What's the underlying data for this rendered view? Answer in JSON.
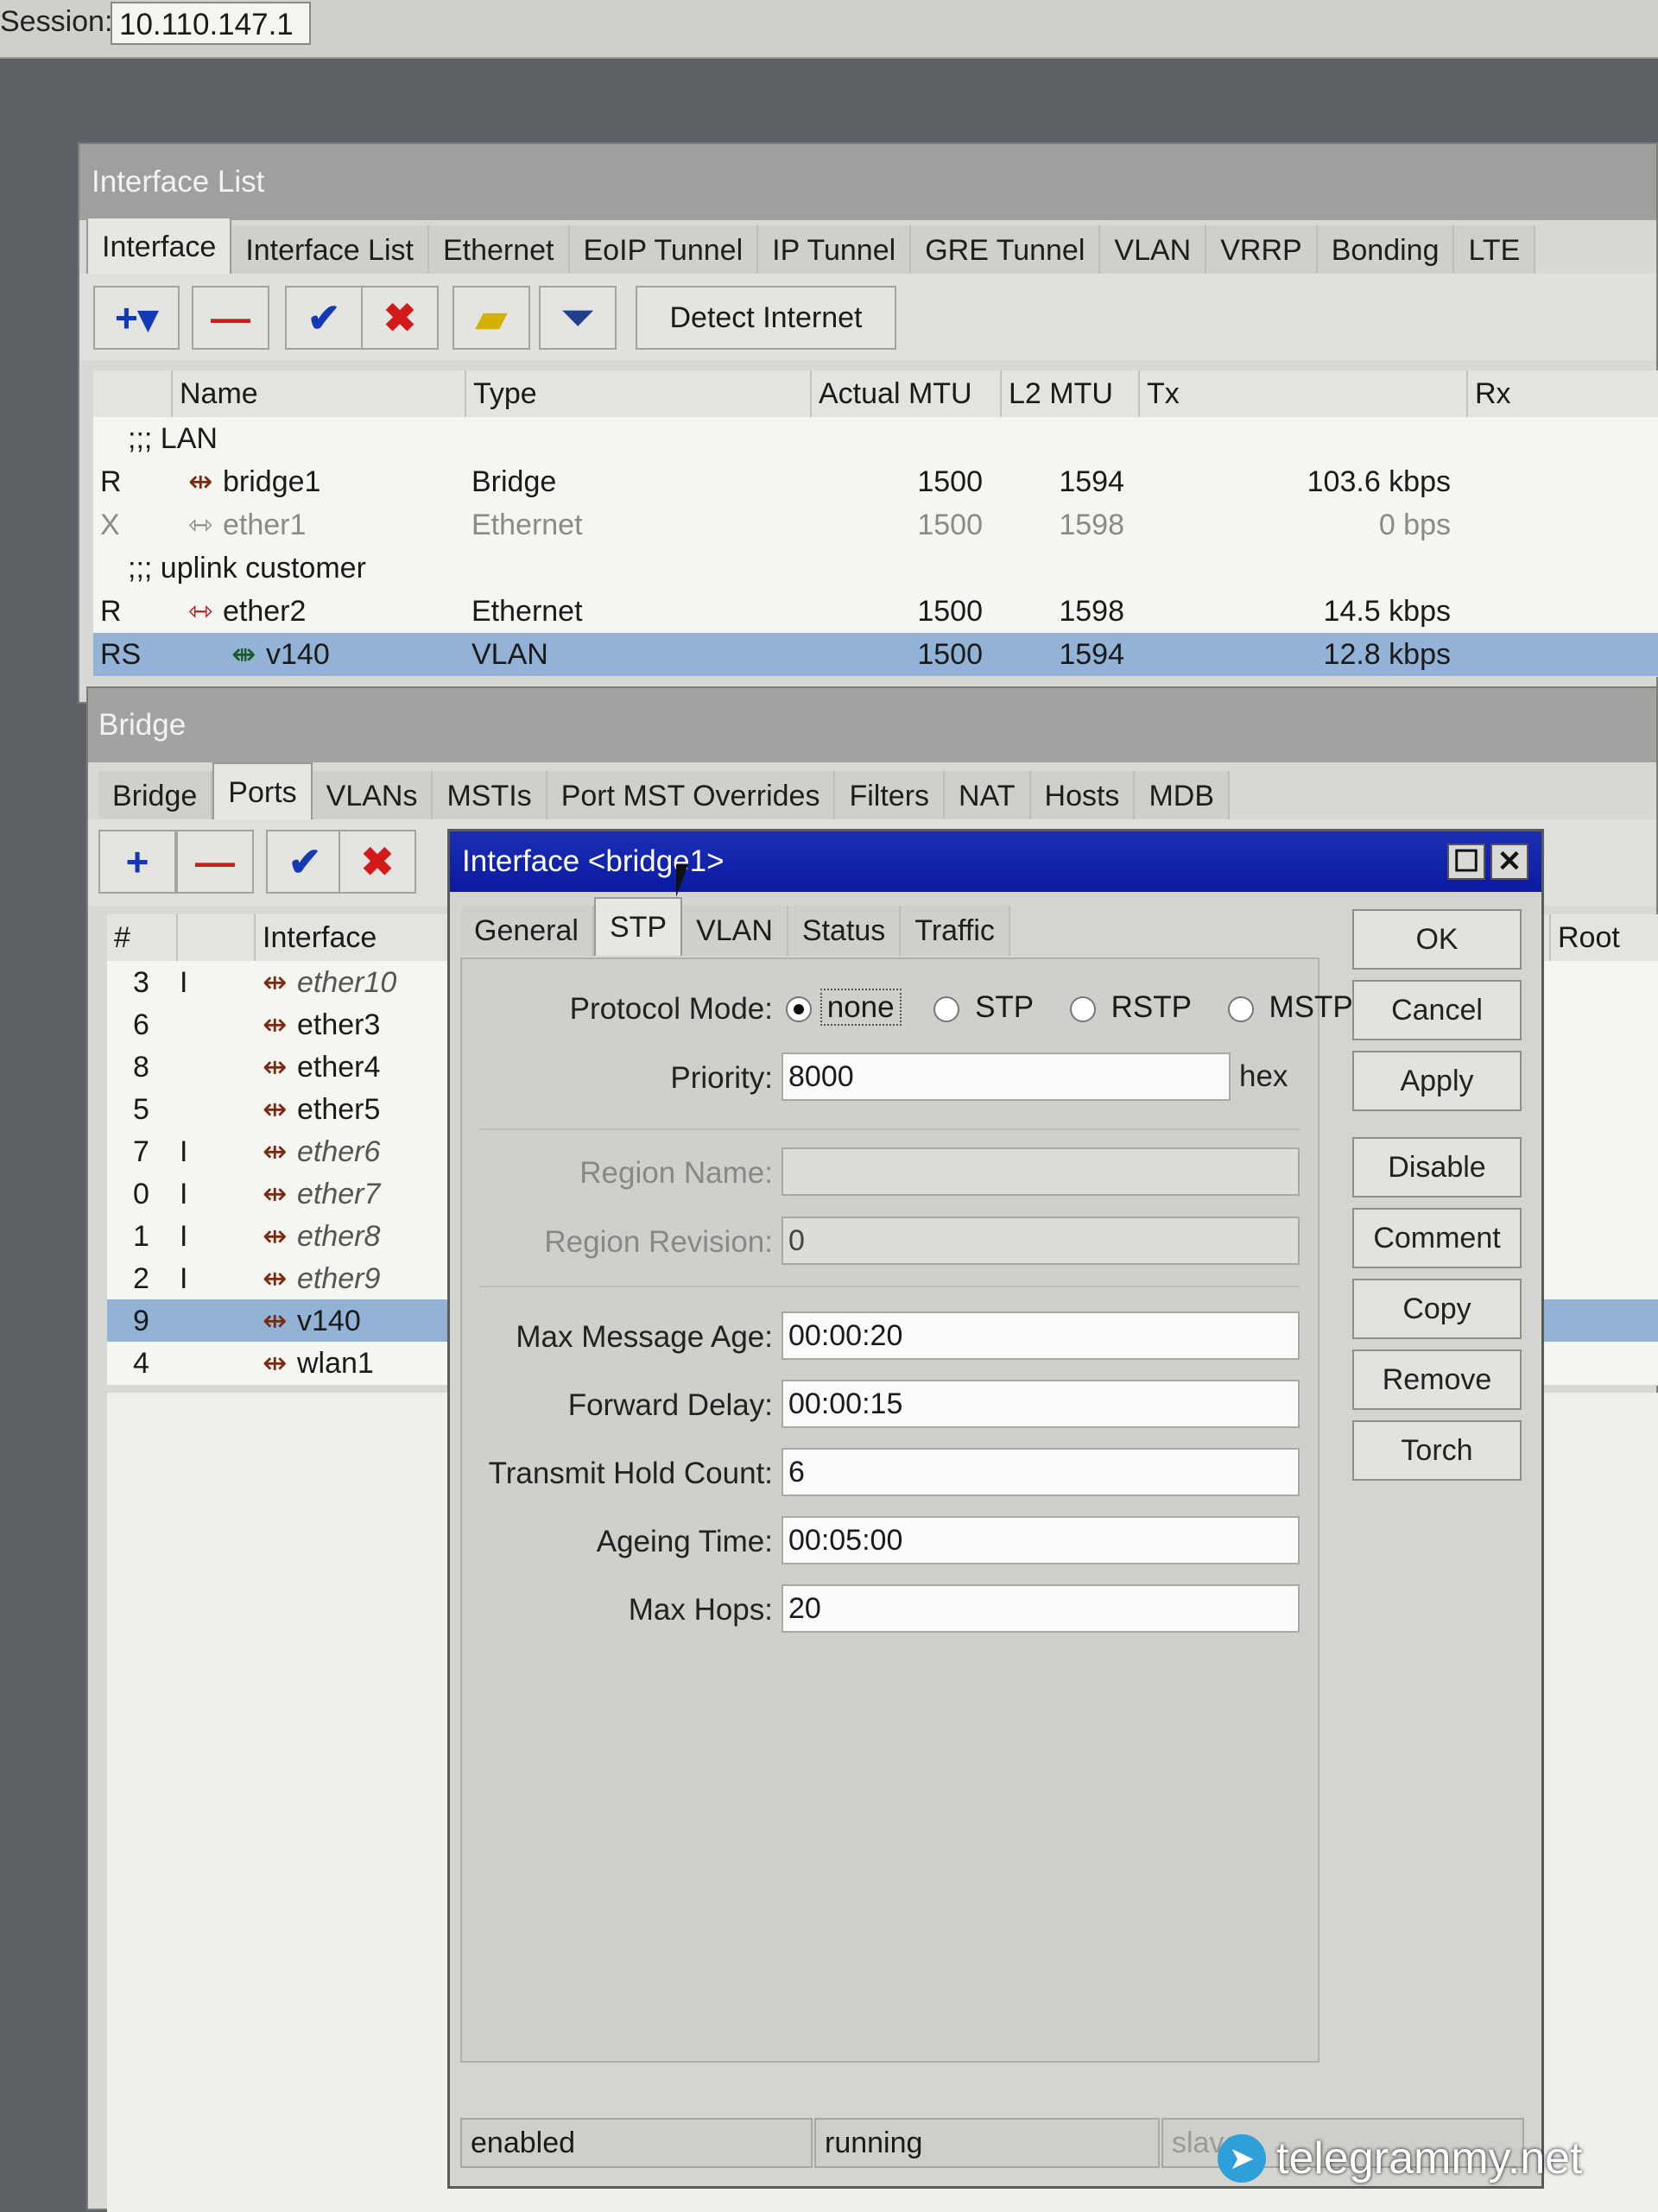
{
  "session": {
    "label": "Session:",
    "value": "10.110.147.1"
  },
  "iflist": {
    "title": "Interface List",
    "tabs": [
      "Interface",
      "Interface List",
      "Ethernet",
      "EoIP Tunnel",
      "IP Tunnel",
      "GRE Tunnel",
      "VLAN",
      "VRRP",
      "Bonding",
      "LTE"
    ],
    "detect_label": "Detect Internet",
    "columns": [
      "Name",
      "Type",
      "Actual MTU",
      "L2 MTU",
      "Tx",
      "Rx"
    ],
    "rows": [
      {
        "flag": "",
        "name": ";;; LAN",
        "type": "",
        "mtu": "",
        "l2mtu": "",
        "tx": ""
      },
      {
        "flag": "R",
        "name": "bridge1",
        "type": "Bridge",
        "mtu": "1500",
        "l2mtu": "1594",
        "tx": "103.6 kbps"
      },
      {
        "flag": "X",
        "name": "ether1",
        "type": "Ethernet",
        "mtu": "1500",
        "l2mtu": "1598",
        "tx": "0 bps"
      },
      {
        "flag": "",
        "name": ";;; uplink customer",
        "type": "",
        "mtu": "",
        "l2mtu": "",
        "tx": ""
      },
      {
        "flag": "R",
        "name": "ether2",
        "type": "Ethernet",
        "mtu": "1500",
        "l2mtu": "1598",
        "tx": "14.5 kbps"
      },
      {
        "flag": "RS",
        "name": "v140",
        "type": "VLAN",
        "mtu": "1500",
        "l2mtu": "1594",
        "tx": "12.8 kbps"
      }
    ]
  },
  "bridge": {
    "title": "Bridge",
    "tabs": [
      "Bridge",
      "Ports",
      "VLANs",
      "MSTIs",
      "Port MST Overrides",
      "Filters",
      "NAT",
      "Hosts",
      "MDB"
    ],
    "columns": [
      "#",
      "Interface"
    ],
    "right_col": "Root Pat",
    "rows": [
      {
        "num": "3",
        "flag": "I",
        "iface": "ether10"
      },
      {
        "num": "6",
        "flag": "",
        "iface": "ether3"
      },
      {
        "num": "8",
        "flag": "",
        "iface": "ether4"
      },
      {
        "num": "5",
        "flag": "",
        "iface": "ether5"
      },
      {
        "num": "7",
        "flag": "I",
        "iface": "ether6"
      },
      {
        "num": "0",
        "flag": "I",
        "iface": "ether7"
      },
      {
        "num": "1",
        "flag": "I",
        "iface": "ether8"
      },
      {
        "num": "2",
        "flag": "I",
        "iface": "ether9"
      },
      {
        "num": "9",
        "flag": "",
        "iface": "v140"
      },
      {
        "num": "4",
        "flag": "",
        "iface": "wlan1"
      }
    ]
  },
  "dialog": {
    "title": "Interface <bridge1>",
    "tabs": [
      "General",
      "STP",
      "VLAN",
      "Status",
      "Traffic"
    ],
    "protocol_mode_label": "Protocol Mode:",
    "protocol_options": [
      "none",
      "STP",
      "RSTP",
      "MSTP"
    ],
    "priority_label": "Priority:",
    "priority_value": "8000",
    "priority_unit": "hex",
    "region_name_label": "Region Name:",
    "region_name_value": "",
    "region_revision_label": "Region Revision:",
    "region_revision_value": "0",
    "max_msg_age_label": "Max Message Age:",
    "max_msg_age_value": "00:00:20",
    "fwd_delay_label": "Forward Delay:",
    "fwd_delay_value": "00:00:15",
    "tx_hold_label": "Transmit Hold Count:",
    "tx_hold_value": "6",
    "ageing_label": "Ageing Time:",
    "ageing_value": "00:05:00",
    "max_hops_label": "Max Hops:",
    "max_hops_value": "20",
    "buttons": [
      "OK",
      "Cancel",
      "Apply",
      "Disable",
      "Comment",
      "Copy",
      "Remove",
      "Torch"
    ],
    "status": [
      "enabled",
      "running",
      "slave"
    ]
  },
  "watermark": "telegrammy.net"
}
